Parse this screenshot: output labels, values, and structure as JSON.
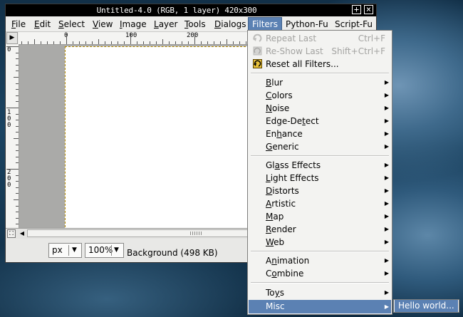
{
  "window": {
    "title": "Untitled-4.0 (RGB, 1 layer) 420x300",
    "maximize_glyph": "+",
    "close_glyph": "×"
  },
  "menubar": {
    "items": [
      {
        "label": "File",
        "key": "F",
        "rest": "ile"
      },
      {
        "label": "Edit",
        "key": "E",
        "rest": "dit"
      },
      {
        "label": "Select",
        "key": "S",
        "rest": "elect"
      },
      {
        "label": "View",
        "key": "V",
        "rest": "iew"
      },
      {
        "label": "Image",
        "key": "I",
        "rest": "mage"
      },
      {
        "label": "Layer",
        "key": "L",
        "rest": "ayer"
      },
      {
        "label": "Tools",
        "key": "T",
        "rest": "ools"
      },
      {
        "label": "Dialogs",
        "key": "D",
        "rest": "ialogs"
      },
      {
        "label": "Filters",
        "key": "",
        "rest": "Filters"
      },
      {
        "label": "Python-Fu",
        "key": "",
        "rest": "Python-Fu"
      },
      {
        "label": "Script-Fu",
        "key": "",
        "rest": "Script-Fu"
      }
    ]
  },
  "rulers": {
    "h_labels": [
      "0",
      "100",
      "200"
    ],
    "v_labels": [
      "0",
      "100",
      "200"
    ]
  },
  "statusbar": {
    "unit": "px",
    "zoom": "100%",
    "status": "Background (498 KB)"
  },
  "filters_menu": {
    "repeat_last": {
      "label": "Repeat Last",
      "shortcut": "Ctrl+F"
    },
    "reshow_last": {
      "label": "Re-Show Last",
      "shortcut": "Shift+Ctrl+F"
    },
    "reset_all": {
      "label": "Reset all Filters..."
    },
    "group1": [
      "Blur",
      "Colors",
      "Noise",
      "Edge-Detect",
      "Enhance",
      "Generic"
    ],
    "group2": [
      "Glass Effects",
      "Light Effects",
      "Distorts",
      "Artistic",
      "Map",
      "Render",
      "Web"
    ],
    "group3": [
      "Animation",
      "Combine"
    ],
    "group4": [
      "Toys",
      "Misc"
    ],
    "submenu_arrow": "▶"
  },
  "misc_submenu": {
    "items": [
      "Hello world..."
    ]
  },
  "colors": {
    "highlight": "#5b81b3",
    "selection_border": "#b38a00"
  }
}
